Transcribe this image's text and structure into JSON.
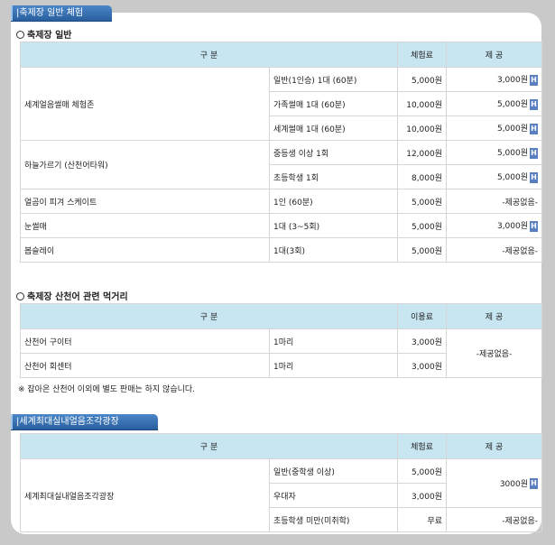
{
  "sections": {
    "tab1": "|축제장 일반 체험",
    "tab2": "|세계최대실내얼음조각광장"
  },
  "general": {
    "heading": "축제장 일반",
    "headers": [
      "구 분",
      "체험료",
      "제 공"
    ],
    "rows": [
      {
        "group": "세계얼음썰매 체험존",
        "item": "일반(1인승) 1대 (60분)",
        "fee": "5,000원",
        "provide": "3,000원",
        "h": "H"
      },
      {
        "item": "가족썰매 1대 (60분)",
        "fee": "10,000원",
        "provide": "5,000원",
        "h": "H"
      },
      {
        "item": "세계썰매 1대 (60분)",
        "fee": "10,000원",
        "provide": "5,000원",
        "h": "H"
      },
      {
        "group": "하늘가르기 (산천어타워)",
        "item": "중등생 이상 1회",
        "fee": "12,000원",
        "provide": "5,000원",
        "h": "H"
      },
      {
        "item": "초등학생 1회",
        "fee": "8,000원",
        "provide": "5,000원",
        "h": "H"
      },
      {
        "group": "얼곰이 피겨 스케이트",
        "item": "1인 (60분)",
        "fee": "5,000원",
        "provide": "-제공없음-"
      },
      {
        "group": "눈썰매",
        "item": "1대 (3~5회)",
        "fee": "5,000원",
        "provide": "3,000원",
        "h": "H"
      },
      {
        "group": "봅슬레이",
        "item": "1대(3회)",
        "fee": "5,000원",
        "provide": "-제공없음-"
      }
    ]
  },
  "food": {
    "heading": "축제장 산천어 관련 먹거리",
    "headers": [
      "구 분",
      "이용료",
      "제 공"
    ],
    "rows": [
      {
        "group": "산천어 구이터",
        "item": "1마리",
        "fee": "3,000원"
      },
      {
        "group": "산천어 회센터",
        "item": "1마리",
        "fee": "3,000원"
      }
    ],
    "provide": "-제공없음-",
    "note": "※ 잡아온 산천어 이외에 별도 판매는 하지 않습니다."
  },
  "ice": {
    "headers": [
      "구 분",
      "체험료",
      "제 공"
    ],
    "group": "세계최대실내얼음조각광장",
    "rows": [
      {
        "item": "일반(중학생 이상)",
        "fee": "5,000원"
      },
      {
        "item": "우대자",
        "fee": "3,000원"
      },
      {
        "item": "초등학생 미만(미취학)",
        "fee": "무료",
        "provide": "-제공없음-"
      }
    ],
    "provide_top": "3000원",
    "h": "H"
  }
}
